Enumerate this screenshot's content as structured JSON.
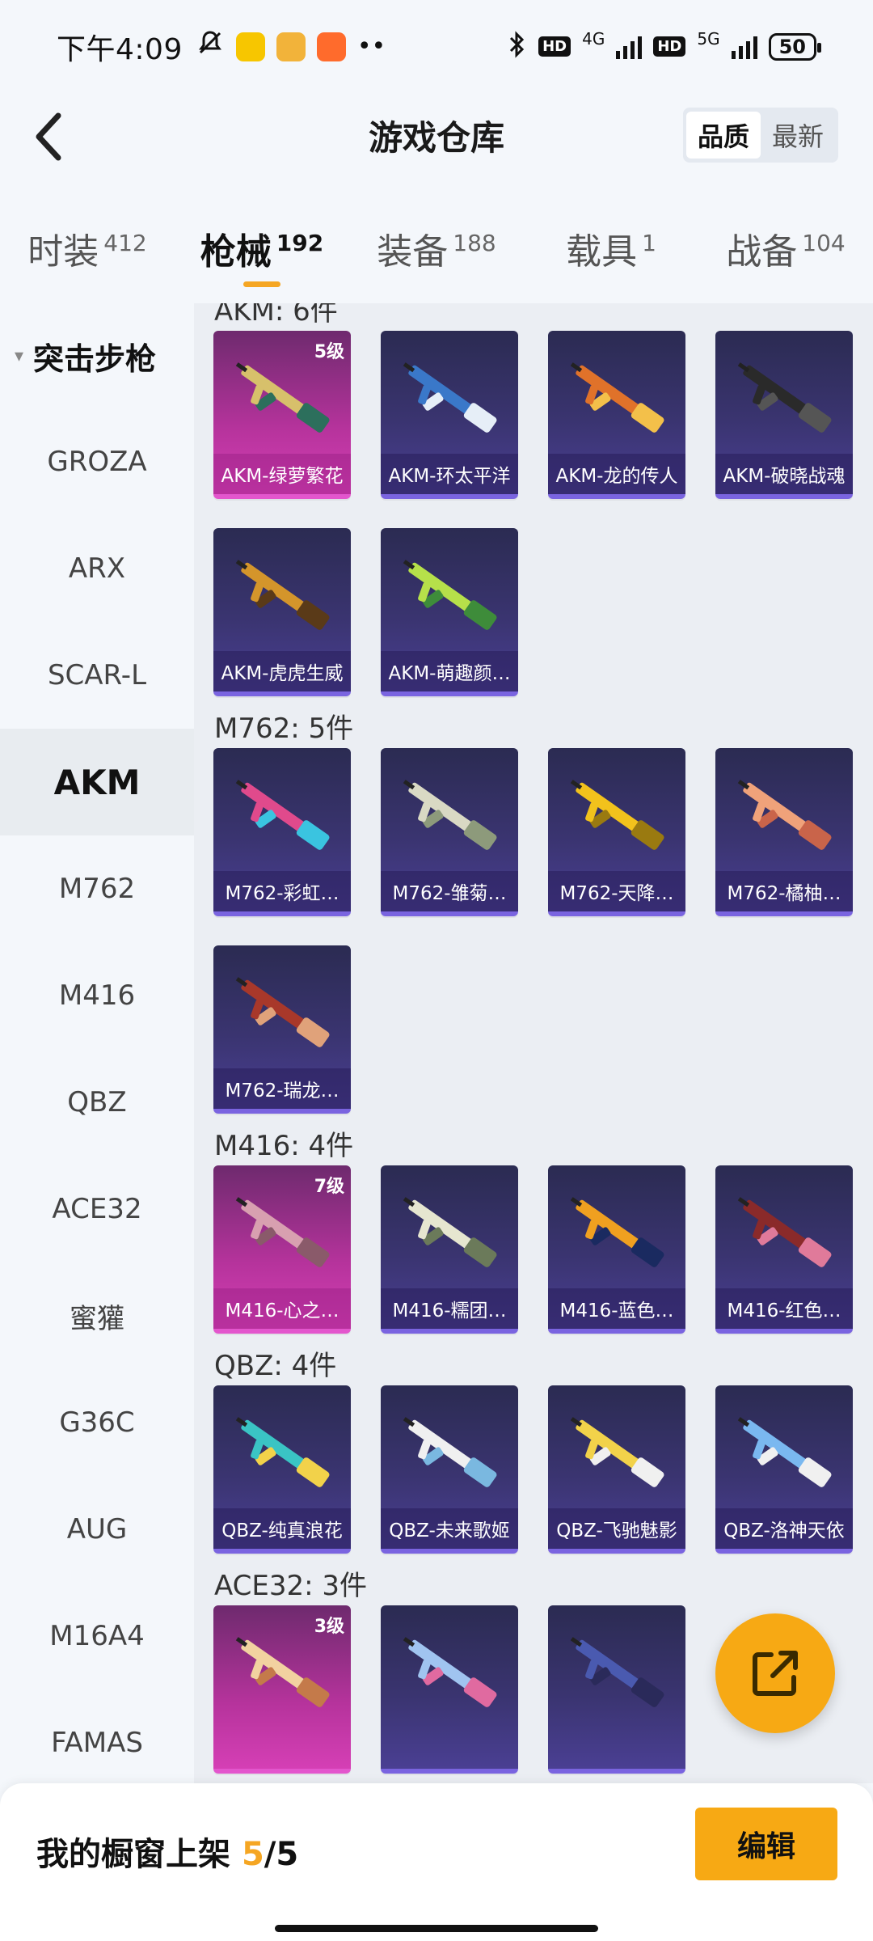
{
  "status": {
    "time": "下午4:09",
    "net1": "4G",
    "net2": "5G",
    "hd": "HD",
    "battery": "50"
  },
  "header": {
    "title": "游戏仓库",
    "sort": {
      "quality": "品质",
      "newest": "最新"
    }
  },
  "tabs": [
    {
      "label": "时装",
      "count": "412"
    },
    {
      "label": "枪械",
      "count": "192"
    },
    {
      "label": "装备",
      "count": "188"
    },
    {
      "label": "载具",
      "count": "1"
    },
    {
      "label": "战备",
      "count": "104"
    }
  ],
  "sidebar": {
    "group": "突击步枪",
    "items": [
      "GROZA",
      "ARX",
      "SCAR-L",
      "AKM",
      "M762",
      "M416",
      "QBZ",
      "ACE32",
      "蜜獾",
      "G36C",
      "AUG",
      "M16A4",
      "FAMAS"
    ]
  },
  "sections": [
    {
      "title": "AKM: 6件",
      "items": [
        {
          "name": "AKM-绿萝繁花",
          "level": "5级"
        },
        {
          "name": "AKM-环太平洋"
        },
        {
          "name": "AKM-龙的传人"
        },
        {
          "name": "AKM-破晓战魂"
        },
        {
          "name": "AKM-虎虎生威"
        },
        {
          "name": "AKM-萌趣颜…"
        }
      ]
    },
    {
      "title": "M762: 5件",
      "items": [
        {
          "name": "M762-彩虹…"
        },
        {
          "name": "M762-雏菊…"
        },
        {
          "name": "M762-天降…"
        },
        {
          "name": "M762-橘柚…"
        },
        {
          "name": "M762-瑞龙…"
        }
      ]
    },
    {
      "title": "M416: 4件",
      "items": [
        {
          "name": "M416-心之…",
          "level": "7级"
        },
        {
          "name": "M416-糯团…"
        },
        {
          "name": "M416-蓝色…"
        },
        {
          "name": "M416-红色…"
        }
      ]
    },
    {
      "title": "QBZ: 4件",
      "items": [
        {
          "name": "QBZ-纯真浪花"
        },
        {
          "name": "QBZ-未来歌姬"
        },
        {
          "name": "QBZ-飞驰魅影"
        },
        {
          "name": "QBZ-洛神天依"
        }
      ]
    },
    {
      "title": "ACE32: 3件",
      "items": [
        {
          "name": "",
          "level": "3级"
        },
        {
          "name": ""
        },
        {
          "name": ""
        }
      ]
    }
  ],
  "bottom": {
    "shelf_label": "我的橱窗上架",
    "shelf_count": "5",
    "shelf_total": "/5",
    "edit": "编辑"
  },
  "colors": {
    "accent": "#f7a914",
    "card": "#3a3470",
    "card_pink": "#b6339c"
  }
}
